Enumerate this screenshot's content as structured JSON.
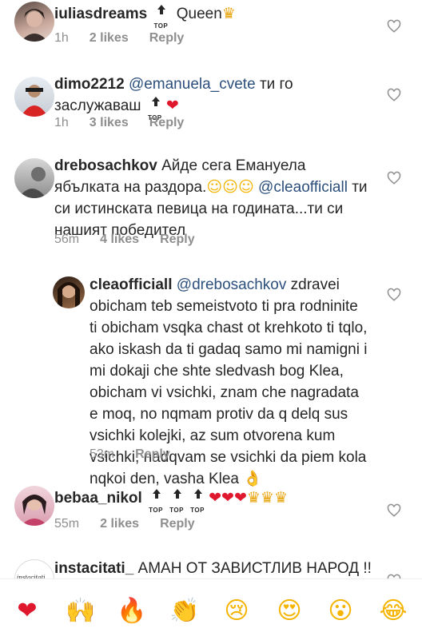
{
  "colors": {
    "text": "#262626",
    "meta": "#8e8e8e",
    "mention": "#2c4f7c",
    "heart": "#ed4956"
  },
  "comments": [
    {
      "username": "iuliasdreams",
      "top_label": "TOP",
      "body": "Queen",
      "time": "1h",
      "likes": "2 likes",
      "reply": "Reply"
    },
    {
      "username": "dimo2212",
      "mention": "@emanuela_cvete",
      "body": "ти го заслужаваш",
      "top_label": "TOP",
      "time": "1h",
      "likes": "3 likes",
      "reply": "Reply"
    },
    {
      "username": "дrebosachkov",
      "username_display": "drebosachkov",
      "body": "Айде сега Емануела ябълката на раздора.",
      "mention": "@cleaofficiall",
      "body2": "ти си истинската певица на годината...ти си нашият победител",
      "time": "56m",
      "likes": "4 likes",
      "reply": "Reply"
    },
    {
      "username": "cleaofficiall",
      "mention": "@drebosachkov",
      "body": "zdravei obicham teb semeistvoto ti pra rodninite ti obicham vsqka chast ot krehkoto ti tqlo, ako iskash da ti gadaq samo mi namigni i mi dokaji che shte sledvash bog Klea, obicham vi vsichki, znam che nagradata e moq, no nqmam protiv da q delq sus vsichki kolejki, az sum otvorena kum vsichki, nadqvam se vsichki da piem kola nqkoi den, vasha Klea",
      "time": "53m",
      "reply": "Reply"
    },
    {
      "username": "bebaa_nikol",
      "top_label": "TOP",
      "time": "55m",
      "likes": "2 likes",
      "reply": "Reply"
    },
    {
      "username": "instacitati_",
      "body": "АМАН ОТ ЗАВИСТЛИВ НАРОД !!",
      "avatar_text": "instacitati"
    }
  ],
  "reactions": [
    {
      "icon": "heart-emoji",
      "glyph": "❤"
    },
    {
      "icon": "raised-hands-emoji",
      "glyph": "🙌"
    },
    {
      "icon": "fire-emoji",
      "glyph": "🔥"
    },
    {
      "icon": "clapping-hands-emoji",
      "glyph": "👏"
    },
    {
      "icon": "crying-face-emoji",
      "glyph": "😢"
    },
    {
      "icon": "heart-eyes-emoji",
      "glyph": "😍"
    },
    {
      "icon": "surprised-face-emoji",
      "glyph": "😮"
    },
    {
      "icon": "tears-of-joy-emoji",
      "glyph": "😂"
    }
  ]
}
